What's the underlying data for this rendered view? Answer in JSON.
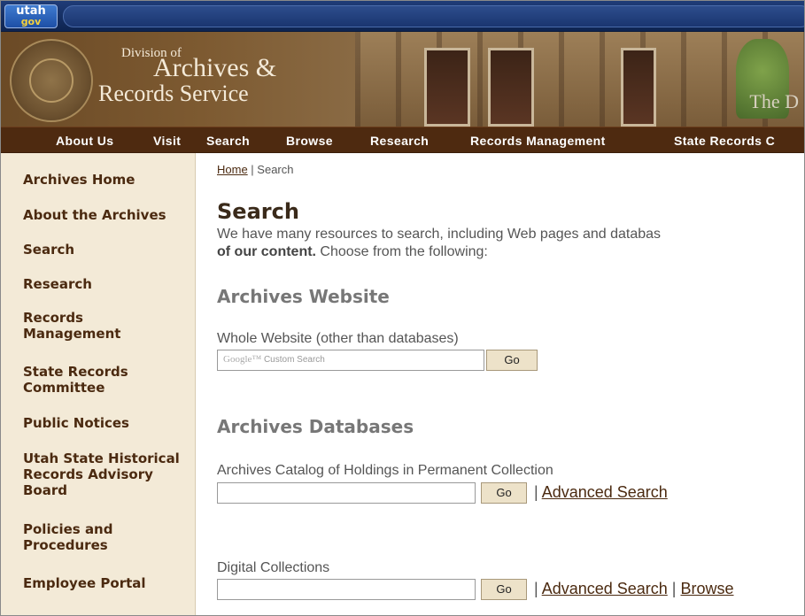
{
  "topbar": {
    "logo_top": "utah",
    "logo_bottom": "gov"
  },
  "banner": {
    "division": "Division of",
    "archives": "Archives &",
    "records": "Records Service",
    "tagline": "The D"
  },
  "main_nav": {
    "items": [
      "About Us",
      "Visit",
      "Search",
      "Browse",
      "Research",
      "Records Management",
      "State Records C"
    ]
  },
  "sidebar": {
    "items": [
      "Archives Home",
      "About the Archives",
      "Search",
      "Research",
      "Records Management",
      "State Records Committee",
      "Public Notices",
      "Utah State Historical Records Advisory Board",
      "Policies and Procedures",
      "Employee Portal"
    ]
  },
  "breadcrumb": {
    "home": "Home",
    "separator": " | ",
    "current": "Search"
  },
  "page": {
    "title": "Search",
    "intro_line1": "We have many resources to search, including Web pages and databas",
    "intro_bold": "of our content.",
    "intro_rest": " Choose from the following:"
  },
  "website_section": {
    "heading": "Archives Website",
    "field_label": "Whole Website (other than databases)",
    "input_google": "Google™",
    "input_placeholder": "Custom Search",
    "go": "Go"
  },
  "databases_section": {
    "heading": "Archives Databases",
    "catalog_label": "Archives Catalog of Holdings in Permanent Collection",
    "catalog_go": "Go",
    "separator": "| ",
    "advanced_search": "Advanced Search",
    "digital_label": "Digital Collections",
    "digital_go": "Go",
    "digital_advanced": "Advanced Search",
    "digital_separator": " | ",
    "browse": "Browse"
  }
}
